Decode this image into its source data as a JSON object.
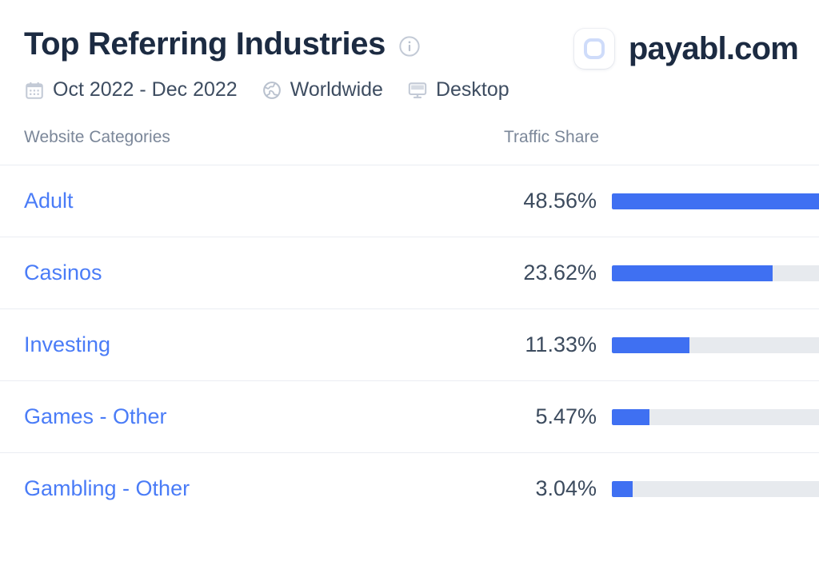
{
  "header": {
    "title": "Top Referring Industries",
    "info_icon": "info-circle-icon",
    "brand": {
      "favicon_icon": "payabl-favicon-icon",
      "name": "payabl.com"
    },
    "meta": [
      {
        "icon": "calendar-icon",
        "label": "Oct 2022 - Dec 2022"
      },
      {
        "icon": "globe-icon",
        "label": "Worldwide"
      },
      {
        "icon": "desktop-monitor-icon",
        "label": "Desktop"
      }
    ]
  },
  "table": {
    "columns": [
      "Website Categories",
      "Traffic Share"
    ],
    "rows": [
      {
        "category": "Adult",
        "share_label": "48.56%",
        "share": 48.56
      },
      {
        "category": "Casinos",
        "share_label": "23.62%",
        "share": 23.62
      },
      {
        "category": "Investing",
        "share_label": "11.33%",
        "share": 11.33
      },
      {
        "category": "Games - Other",
        "share_label": "5.47%",
        "share": 5.47
      },
      {
        "category": "Gambling - Other",
        "share_label": "3.04%",
        "share": 3.04
      }
    ]
  },
  "colors": {
    "bar_fill": "#3f70f2",
    "bar_track": "#e7eaee",
    "link": "#4a7cf7",
    "title": "#1c2b42",
    "muted": "#7b8799"
  },
  "chart_data": {
    "type": "bar",
    "title": "Top Referring Industries",
    "categories": [
      "Adult",
      "Casinos",
      "Investing",
      "Games - Other",
      "Gambling - Other"
    ],
    "values": [
      48.56,
      23.62,
      11.33,
      5.47,
      3.04
    ],
    "xlabel": "Traffic Share",
    "ylabel": "Website Categories",
    "xlim": [
      0,
      50
    ],
    "value_suffix": "%",
    "grid": false,
    "legend": "none",
    "orientation": "horizontal"
  }
}
